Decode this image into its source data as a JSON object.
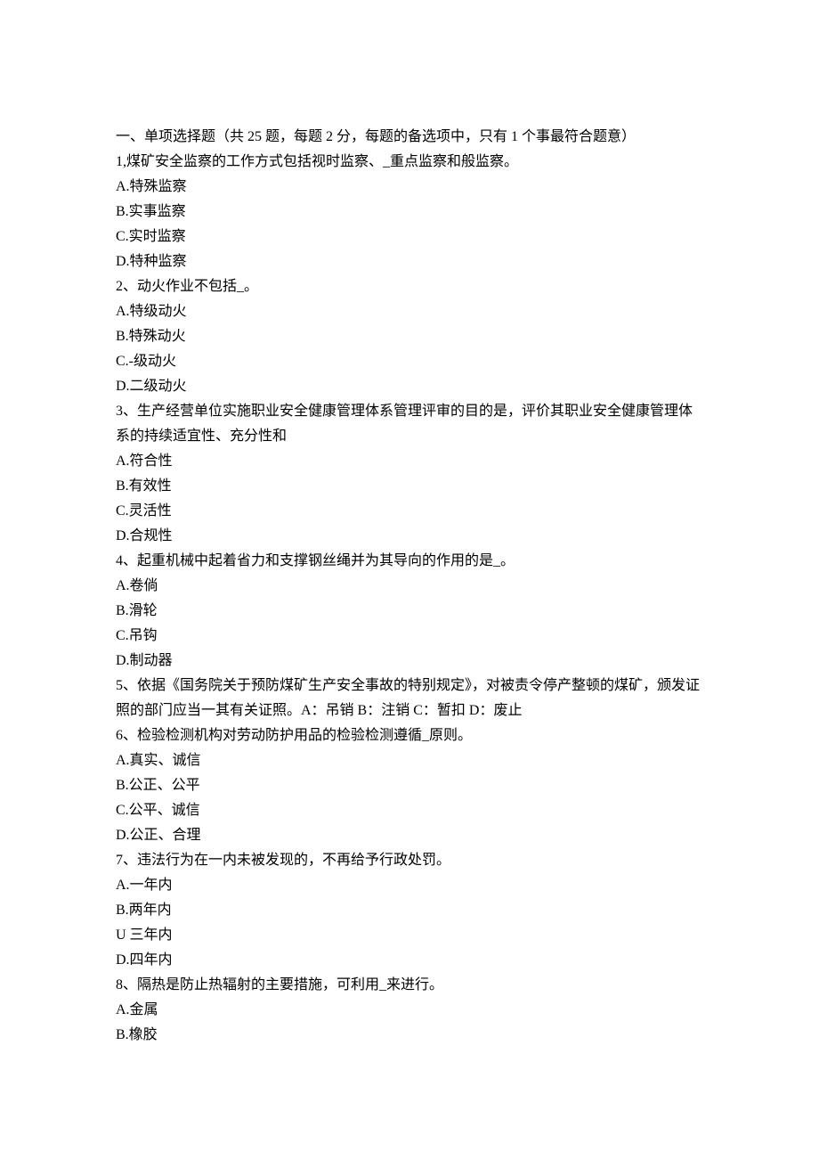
{
  "header": "一、单项选择题（共 25 题，每题 2 分，每题的备选项中，只有 1 个事最符合题意）",
  "questions": [
    {
      "stem": "1,煤矿安全监察的工作方式包括视时监察、_重点监察和般监察。",
      "opts": [
        "A.特殊监察",
        "B.实事监察",
        "C.实时监察",
        "D.特种监察"
      ]
    },
    {
      "stem": "2、动火作业不包括_。",
      "opts": [
        "A.特级动火",
        "B.特殊动火",
        "C.-级动火",
        "D.二级动火"
      ]
    },
    {
      "stem": "3、生产经营单位实施职业安全健康管理体系管理评审的目的是，评价其职业安全健康管理体系的持续适宜性、充分性和",
      "opts": [
        "A.符合性",
        "B.有效性",
        "C.灵活性",
        "D.合规性"
      ]
    },
    {
      "stem": "4、起重机械中起着省力和支撑钢丝绳并为其导向的作用的是_。",
      "opts": [
        "A.卷倘",
        "B.滑轮",
        "C.吊钩",
        "D.制动器"
      ]
    },
    {
      "stem": "5、依据《国务院关于预防煤矿生产安全事故的特别规定》，对被责令停产整顿的煤矿，颁发证照的部门应当一其有关证照。A：吊销 B：注销 C：暂扣 D：废止",
      "opts": []
    },
    {
      "stem": "6、检验检测机构对劳动防护用品的检验检测遵循_原则。",
      "opts": [
        "A.真实、诚信",
        "B.公正、公平",
        "C.公平、诚信",
        "D.公正、合理"
      ]
    },
    {
      "stem": "7、违法行为在一内未被发现的，不再给予行政处罚。",
      "opts": [
        "A.一年内",
        "B.两年内",
        "U 三年内",
        "D.四年内"
      ]
    },
    {
      "stem": "8、隔热是防止热辐射的主要措施，可利用_来进行。",
      "opts": [
        "A.金属",
        "B.橡胶"
      ]
    }
  ]
}
